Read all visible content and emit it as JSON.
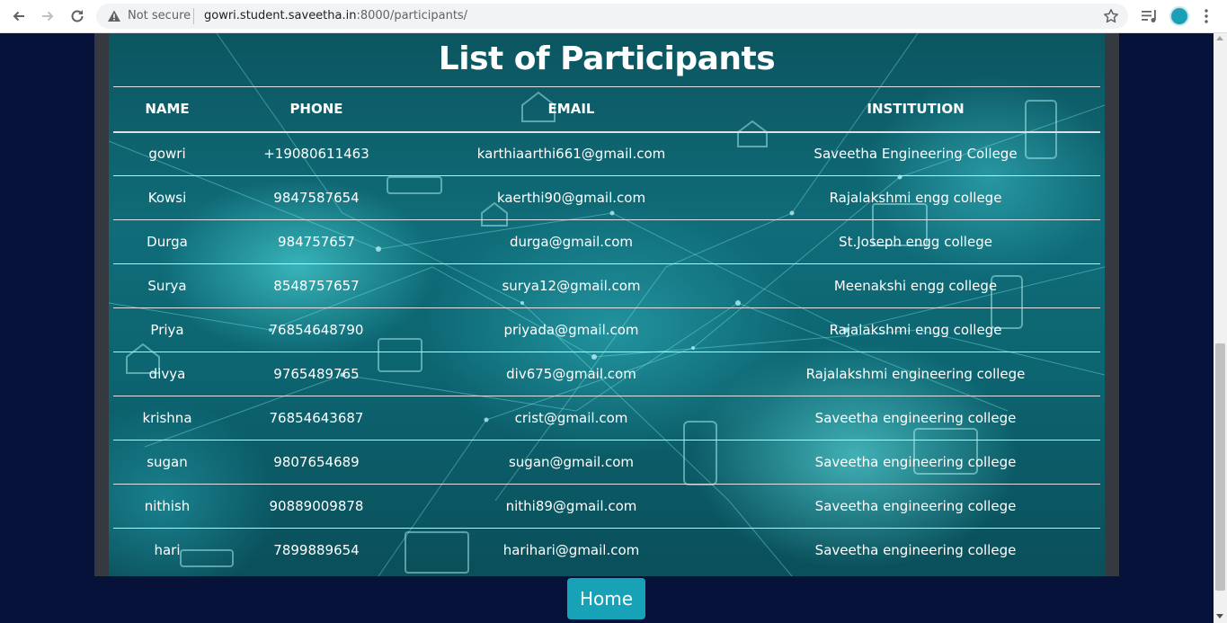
{
  "browser": {
    "security_label": "Not secure",
    "url_host": "gowri.student.saveetha.in",
    "url_path": ":8000/participants/"
  },
  "page": {
    "title": "List of Participants",
    "home_label": "Home"
  },
  "table": {
    "headers": {
      "name": "NAME",
      "phone": "PHONE",
      "email": "EMAIL",
      "institution": "INSTITUTION"
    },
    "rows": [
      {
        "name": "gowri",
        "phone": "+19080611463",
        "email": "karthiaarthi661@gmail.com",
        "institution": "Saveetha Engineering College"
      },
      {
        "name": "Kowsi",
        "phone": "9847587654",
        "email": "kaerthi90@gmail.com",
        "institution": "Rajalakshmi engg college"
      },
      {
        "name": "Durga",
        "phone": "984757657",
        "email": "durga@gmail.com",
        "institution": "St.Joseph engg college"
      },
      {
        "name": "Surya",
        "phone": "8548757657",
        "email": "surya12@gmail.com",
        "institution": "Meenakshi engg college"
      },
      {
        "name": "Priya",
        "phone": "76854648790",
        "email": "priyada@gmail.com",
        "institution": "Rajalakshmi engg college"
      },
      {
        "name": "divya",
        "phone": "9765489765",
        "email": "div675@gmail.com",
        "institution": "Rajalakshmi engineering college"
      },
      {
        "name": "krishna",
        "phone": "76854643687",
        "email": "crist@gmail.com",
        "institution": "Saveetha engineering college"
      },
      {
        "name": "sugan",
        "phone": "9807654689",
        "email": "sugan@gmail.com",
        "institution": "Saveetha engineering college"
      },
      {
        "name": "nithish",
        "phone": "90889009878",
        "email": "nithi89@gmail.com",
        "institution": "Saveetha engineering college"
      },
      {
        "name": "hari",
        "phone": "7899889654",
        "email": "harihari@gmail.com",
        "institution": "Saveetha engineering college"
      }
    ]
  },
  "colors": {
    "page_background": "#06123a",
    "button_accent": "#17a2b8",
    "panel": "#343a40"
  },
  "icons": [
    "back-arrow-icon",
    "forward-arrow-icon",
    "reload-icon",
    "warning-icon",
    "star-icon",
    "media-control-icon",
    "profile-icon",
    "menu-icon"
  ]
}
